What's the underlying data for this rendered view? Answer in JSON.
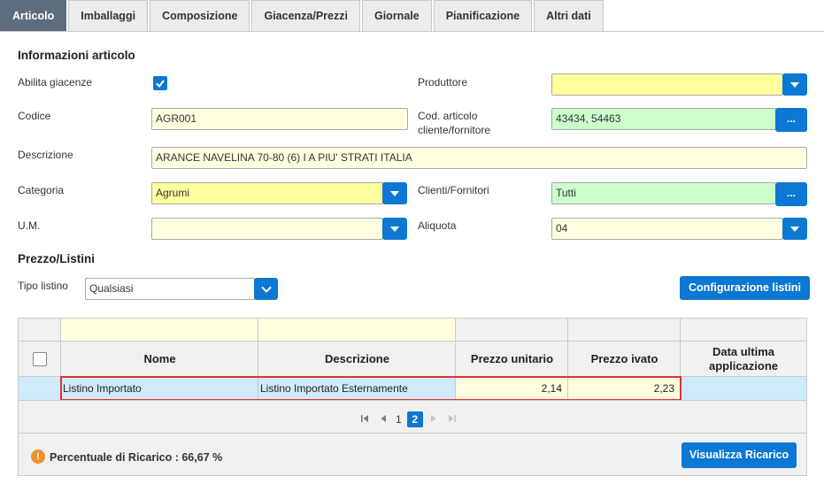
{
  "tabs": [
    "Articolo",
    "Imballaggi",
    "Composizione",
    "Giacenza/Prezzi",
    "Giornale",
    "Pianificazione",
    "Altri dati"
  ],
  "section_info": "Informazioni articolo",
  "labels": {
    "abilita_giacenze": "Abilita giacenze",
    "produttore": "Produttore",
    "codice": "Codice",
    "cod_articolo_1": "Cod. articolo",
    "cod_articolo_2": "cliente/fornitore",
    "descrizione": "Descrizione",
    "categoria": "Categoria",
    "clienti_fornitori": "Clienti/Fornitori",
    "um": "U.M.",
    "aliquota": "Aliquota",
    "tipo_listino": "Tipo listino"
  },
  "values": {
    "produttore": "",
    "codice": "AGR001",
    "cod_articolo": "43434, 54463",
    "descrizione": "ARANCE NAVELINA 70-80 (6) I A PIU' STRATI    ITALIA",
    "categoria": "Agrumi",
    "clienti_fornitori": "Tutti",
    "um": "",
    "aliquota": "04",
    "tipo_listino": "Qualsiasi"
  },
  "section_prezzo": "Prezzo/Listini",
  "buttons": {
    "dots": "...",
    "configurazione": "Configurazione listini",
    "visualizza": "Visualizza Ricarico"
  },
  "grid": {
    "headers": {
      "nome": "Nome",
      "descrizione": "Descrizione",
      "prezzo_unitario": "Prezzo unitario",
      "prezzo_ivato": "Prezzo ivato",
      "data_1": "Data ultima",
      "data_2": "applicazione"
    },
    "row": {
      "nome": "Listino Importato",
      "descrizione": "Listino Importato Esternamente",
      "prezzo_unitario": "2,14",
      "prezzo_ivato": "2,23",
      "data": ""
    },
    "pager": {
      "pages": [
        "1",
        "2"
      ],
      "active": "2"
    }
  },
  "footer": {
    "info_glyph": "!",
    "text": "Percentuale di Ricarico : 66,67 %"
  },
  "colors": {
    "accent": "#0c78d4",
    "active_tab": "#5d6d7e",
    "yellow_field": "#ffff9e",
    "light_yellow_field": "#ffffe0",
    "green_field": "#ccffcc",
    "highlight_border": "#e03131",
    "selected_row": "#cfeafa",
    "info_icon": "#f0902a"
  }
}
